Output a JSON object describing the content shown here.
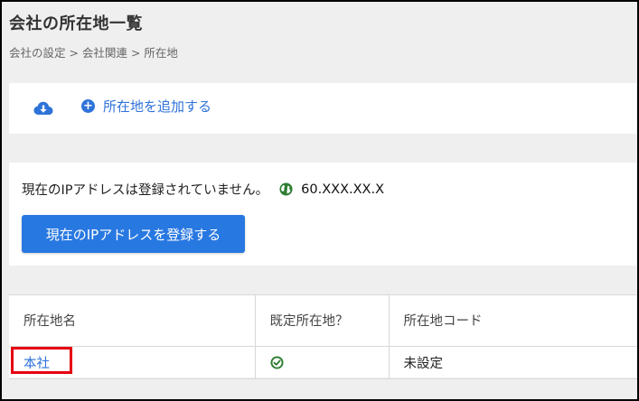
{
  "page": {
    "title": "会社の所在地一覧",
    "breadcrumb": "会社の設定 > 会社関連 > 所在地"
  },
  "toolbar": {
    "download_icon": "cloud-download-icon",
    "add_label": "所在地を追加する",
    "accent_color": "#2f73d9"
  },
  "ip": {
    "message": "現在のIPアドレスは登録されていません。",
    "value": "60.XXX.XX.X",
    "register_label": "現在のIPアドレスを登録する",
    "button_color": "#2878e1"
  },
  "table": {
    "headers": [
      "所在地名",
      "既定所在地？",
      "所在地コード"
    ],
    "rows": [
      {
        "name": "本社",
        "is_default": true,
        "code": "未設定"
      }
    ]
  },
  "highlight_color": "#e60012"
}
